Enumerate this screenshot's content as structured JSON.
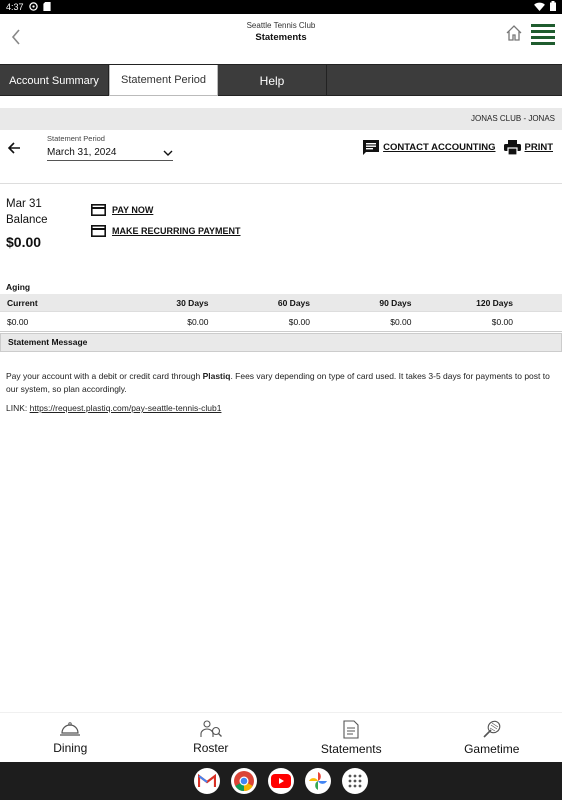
{
  "status_bar": {
    "time": "4:37"
  },
  "header": {
    "club_name": "Seattle Tennis Club",
    "page_title": "Statements"
  },
  "tabs": [
    {
      "label": "Account Summary"
    },
    {
      "label": "Statement Period"
    },
    {
      "label": "Help"
    }
  ],
  "club_bar": {
    "text": "JONAS CLUB - JONAS"
  },
  "period": {
    "label": "Statement Period",
    "value": "March 31, 2024"
  },
  "actions": {
    "contact_label": "CONTACT ACCOUNTING",
    "print_label": "PRINT"
  },
  "balance": {
    "date": "Mar 31",
    "label": "Balance",
    "amount": "$0.00"
  },
  "pay_links": {
    "pay_now": "PAY NOW",
    "recurring": "MAKE RECURRING PAYMENT"
  },
  "aging": {
    "title": "Aging",
    "columns": [
      "Current",
      "30 Days",
      "60 Days",
      "90 Days",
      "120 Days"
    ],
    "values": [
      "$0.00",
      "$0.00",
      "$0.00",
      "$0.00",
      "$0.00"
    ]
  },
  "message": {
    "title": "Statement Message",
    "text_before": "Pay your account with a debit or credit card through ",
    "brand": "Plastiq",
    "text_after": ". Fees vary depending on type of card used. It takes 3-5 days for payments to post to our system, so plan accordingly.",
    "link_prefix": "LINK: ",
    "link_url": "https://request.plastiq.com/pay-seattle-tennis-club1"
  },
  "bottom_nav": [
    {
      "label": "Dining",
      "icon": "dining-cloche-icon"
    },
    {
      "label": "Roster",
      "icon": "roster-people-icon"
    },
    {
      "label": "Statements",
      "icon": "statements-document-icon"
    },
    {
      "label": "Gametime",
      "icon": "tennis-racket-icon"
    }
  ],
  "colors": {
    "tab_bar": "#3c3c3c",
    "accent_green": "#1f5c2e",
    "gray_band": "#e9e9e9"
  }
}
